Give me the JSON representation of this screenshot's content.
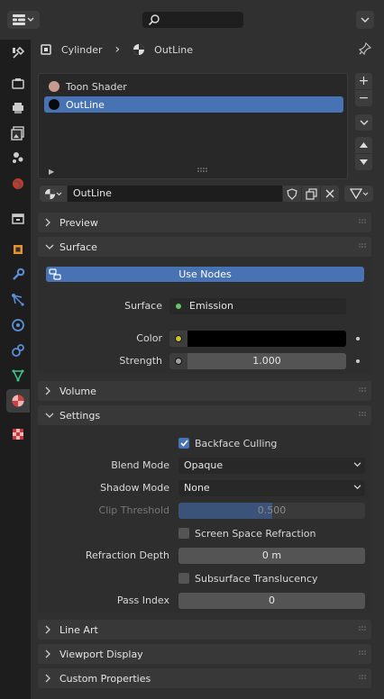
{
  "header": {
    "editor_icon": "properties-editor-icon",
    "search_placeholder": ""
  },
  "breadcrumb": {
    "object": "Cylinder",
    "material": "OutLine"
  },
  "material_slots": [
    {
      "name": "Toon Shader",
      "color": "#c89b8e",
      "selected": false
    },
    {
      "name": "OutLine",
      "color": "#0a0a0a",
      "selected": true
    }
  ],
  "material": {
    "name": "OutLine"
  },
  "panels": {
    "preview": "Preview",
    "surface": "Surface",
    "volume": "Volume",
    "settings": "Settings",
    "line_art": "Line Art",
    "viewport_display": "Viewport Display",
    "custom_properties": "Custom Properties"
  },
  "surface": {
    "use_nodes_label": "Use Nodes",
    "surface_label": "Surface",
    "surface_value": "Emission",
    "color_label": "Color",
    "color_value": "#000000",
    "strength_label": "Strength",
    "strength_value": "1.000"
  },
  "settings": {
    "backface_culling_label": "Backface Culling",
    "backface_culling": true,
    "blend_mode_label": "Blend Mode",
    "blend_mode_value": "Opaque",
    "shadow_mode_label": "Shadow Mode",
    "shadow_mode_value": "None",
    "clip_threshold_label": "Clip Threshold",
    "clip_threshold_value": "0.500",
    "clip_threshold_fraction": 0.5,
    "ssr_label": "Screen Space Refraction",
    "ssr": false,
    "refraction_depth_label": "Refraction Depth",
    "refraction_depth_value": "0 m",
    "subsurface_label": "Subsurface Translucency",
    "subsurface": false,
    "pass_index_label": "Pass Index",
    "pass_index_value": "0"
  },
  "colors": {
    "accent": "#4772b3",
    "socket_green": "#63c763",
    "socket_yellow": "#c7c729",
    "socket_grey": "#a1a1a1"
  }
}
